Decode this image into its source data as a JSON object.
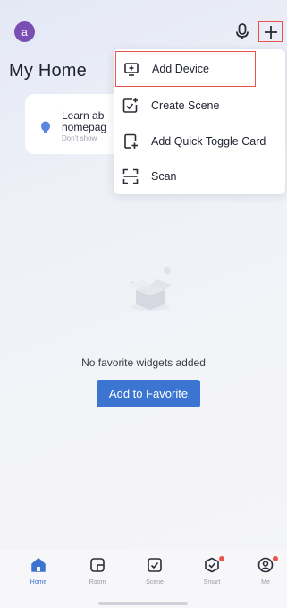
{
  "header": {
    "avatar_letter": "a",
    "page_title": "My Home"
  },
  "tip_card": {
    "line1": "Learn ab",
    "line2": "homepag",
    "sub": "Don't show"
  },
  "add_menu": {
    "items": [
      {
        "label": "Add Device",
        "icon": "add-device-icon"
      },
      {
        "label": "Create Scene",
        "icon": "create-scene-icon"
      },
      {
        "label": "Add Quick Toggle Card",
        "icon": "quick-toggle-icon"
      },
      {
        "label": "Scan",
        "icon": "scan-icon"
      }
    ]
  },
  "main": {
    "empty_text": "No favorite widgets added",
    "add_favorite_label": "Add to Favorite"
  },
  "tabbar": {
    "tabs": [
      {
        "label": "Home",
        "icon": "home-icon",
        "active": true
      },
      {
        "label": "Room",
        "icon": "room-icon",
        "active": false
      },
      {
        "label": "Scene",
        "icon": "scene-icon",
        "active": false
      },
      {
        "label": "Smart",
        "icon": "smart-icon",
        "active": false,
        "badge": true
      },
      {
        "label": "Me",
        "icon": "me-icon",
        "active": false,
        "badge": true
      }
    ]
  },
  "colors": {
    "accent": "#3b74d1",
    "highlight": "#e8534a",
    "avatar": "#7a4fb3"
  }
}
